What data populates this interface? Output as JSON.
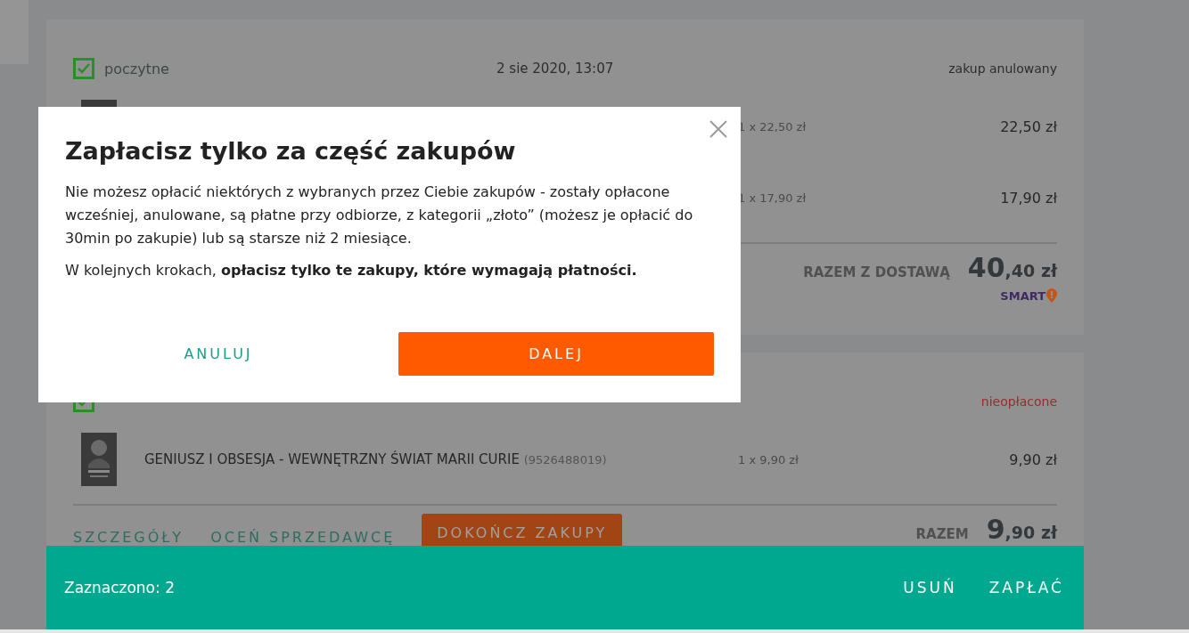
{
  "orders": [
    {
      "seller": "poczytne",
      "selected": true,
      "date": "2 sie 2020, 13:07",
      "status": "zakup anulowany",
      "color": "#2d2d2d",
      "items": [
        {
          "kind": "picture",
          "unit_price": "1 x 22,50 zł",
          "price": "22,50 zł"
        },
        {
          "unit_price": "1 x 17,90 zł",
          "price": "17,90 zł"
        }
      ],
      "total_label": "RAZEM Z DOSTAWĄ",
      "total_main": "40",
      "total_fraction": ",40 zł",
      "badge": "SMART"
    },
    {
      "selected": true,
      "status": "nieopłacone",
      "color": "#9b2b2b",
      "items": [
        {
          "kind": "picture",
          "title": "GENIUSZ I OBSESJA - WEWNĘTRZNY ŚWIAT MARII CURIE",
          "code": "(9526488019)",
          "unit_price": "1 x 9,90 zł",
          "price": "9,90 zł"
        }
      ],
      "total_label": "RAZEM",
      "total_main": "9",
      "total_fraction": ",90 zł",
      "actions": [
        {
          "label": "SZCZEGÓŁY",
          "kind": "link"
        },
        {
          "label": "OCEŃ SPRZEDAWCĘ",
          "kind": "link"
        },
        {
          "label": "DOKOŃCZ ZAKUPY",
          "kind": "primary"
        }
      ]
    }
  ],
  "modal": {
    "title": "Zapłacisz tylko za część zakupów",
    "paragraphs": [
      "Nie możesz opłacić niektórych z wybranych przez Ciebie zakupów - zostały opłacone wcześniej, anulowane, są płatne przy odbiorze, z kategorii „złoto” (możesz je opłacić do 30min po zakupie) lub są starsze niż 2 miesiące.",
      "W kolejnych krokach, **opłacisz tylko te zakupy, które wymagają płatności.**"
    ],
    "cancel": "ANULUJ",
    "confirm": "DALEJ"
  },
  "selection_bar": {
    "label": "Zaznaczono: 2",
    "actions": [
      "USUŃ",
      "ZAPŁAĆ"
    ]
  }
}
